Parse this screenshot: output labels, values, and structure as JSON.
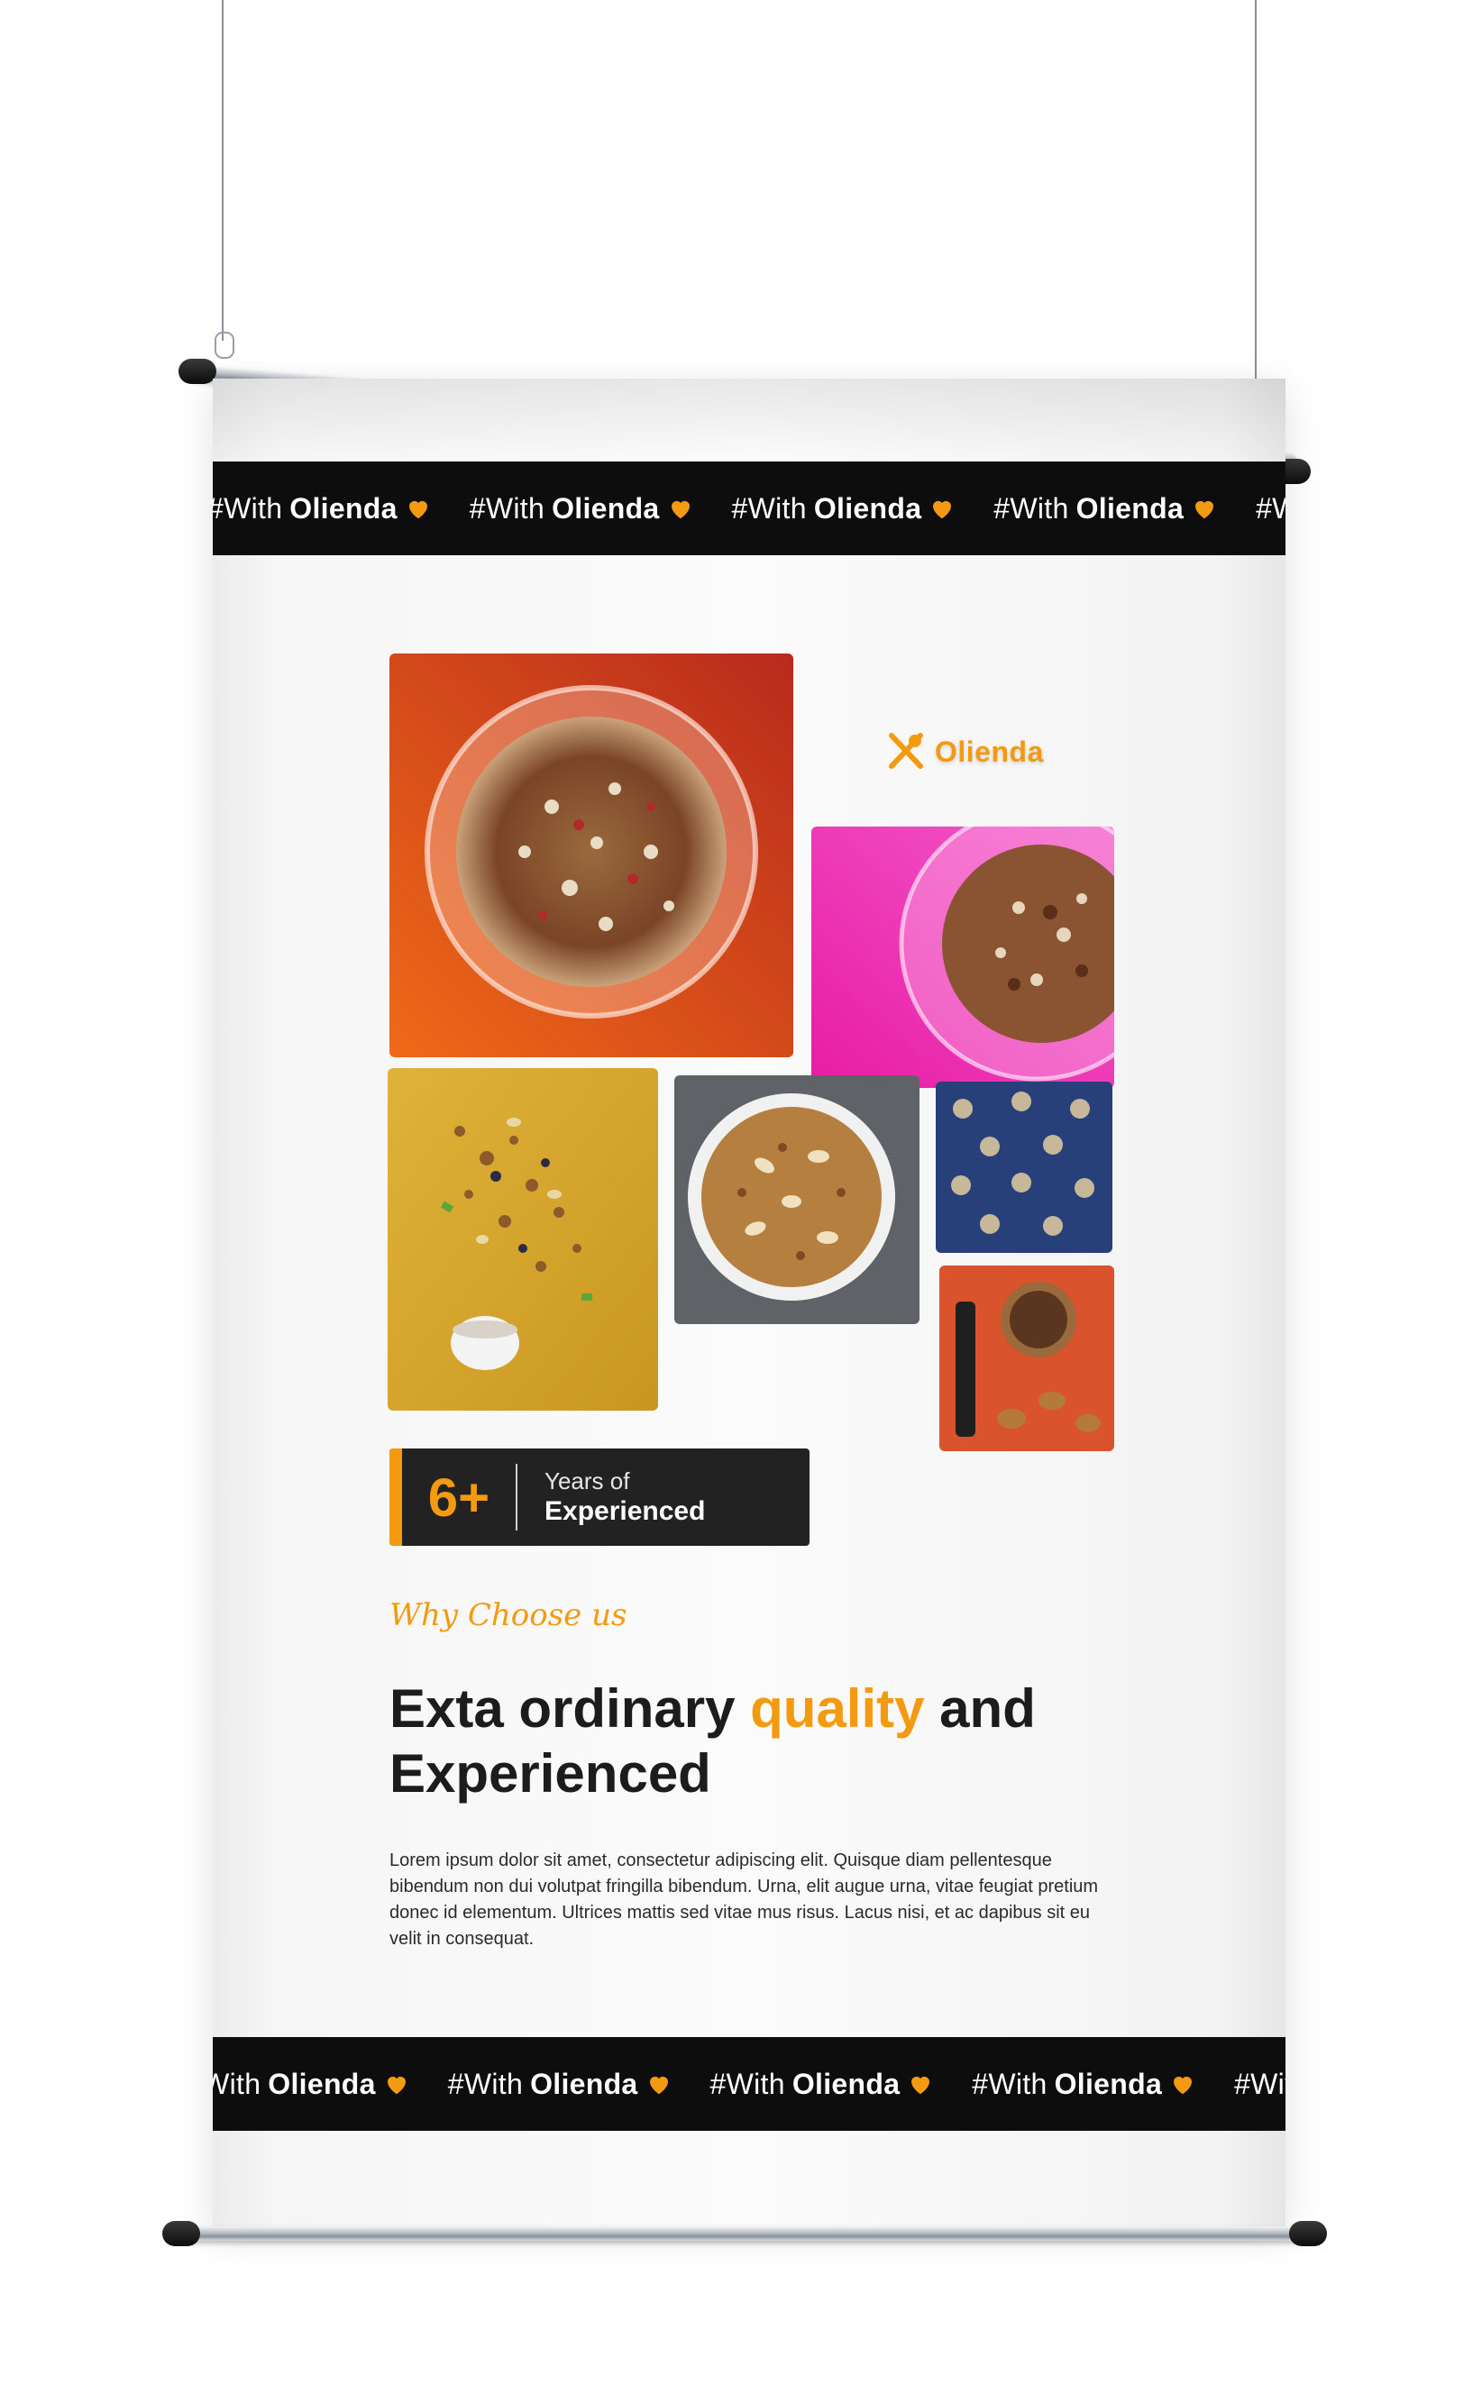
{
  "ticker": {
    "hashtag_prefix": "#With",
    "hashtag_brand": "Olienda",
    "heart_icon": "orange-heart-icon"
  },
  "logo": {
    "brand": "Olienda",
    "icon": "fork-spoon-icon"
  },
  "stat": {
    "number": "6+",
    "label_line1": "Years of",
    "label_line2": "Experienced"
  },
  "eyebrow": "Why Choose us",
  "headline": {
    "part1": "Exta ordinary ",
    "highlight": "quality",
    "part2": " and Experienced"
  },
  "body": "Lorem ipsum dolor sit amet, consectetur adipiscing elit. Quisque diam pellentesque bibendum non dui volutpat fringilla bibendum. Urna, elit augue urna, vitae feugiat pretium donec id elementum. Ultrices mattis sed vitae mus risus. Lacus nisi, et ac dapibus sit eu velit in consequat.",
  "colors": {
    "accent": "#f39a11",
    "dark": "#0d0d0d",
    "card": "#222222"
  }
}
